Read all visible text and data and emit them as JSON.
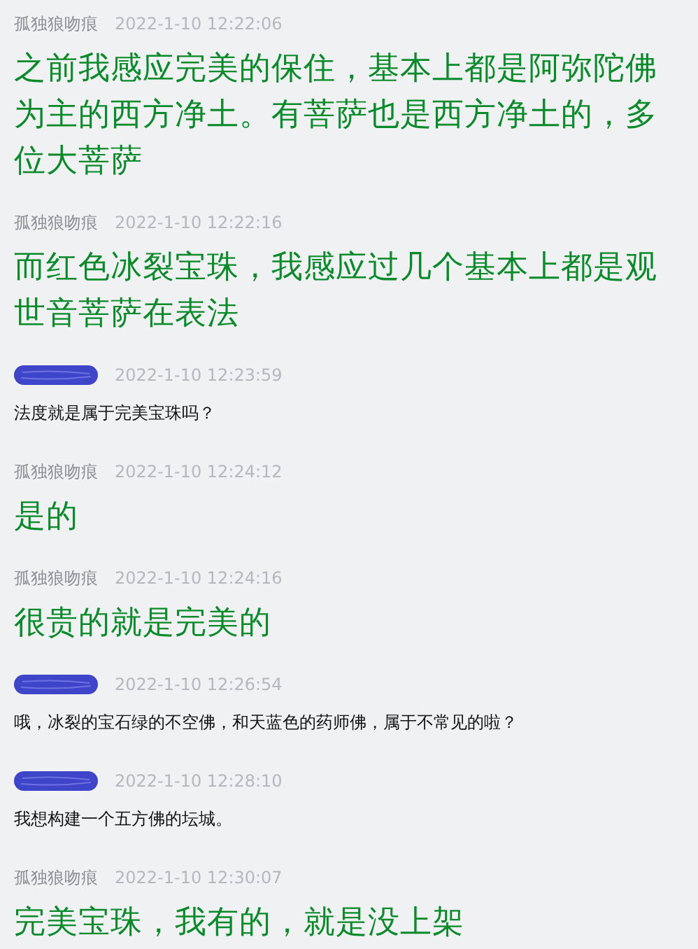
{
  "messages": [
    {
      "sender": "孤独狼吻痕",
      "redacted": false,
      "time": "2022-1-10 12:22:06",
      "kind": "emphasis",
      "text": "之前我感应完美的保住，基本上都是阿弥陀佛为主的西方净土。有菩萨也是西方净土的，多位大菩萨"
    },
    {
      "sender": "孤独狼吻痕",
      "redacted": false,
      "time": "2022-1-10 12:22:16",
      "kind": "emphasis",
      "text": "而红色冰裂宝珠，我感应过几个基本上都是观世音菩萨在表法"
    },
    {
      "redacted": true,
      "time": "2022-1-10 12:23:59",
      "kind": "plain",
      "text": "法度就是属于完美宝珠吗？"
    },
    {
      "sender": "孤独狼吻痕",
      "redacted": false,
      "time": "2022-1-10 12:24:12",
      "kind": "emphasis",
      "text": "是的"
    },
    {
      "sender": "孤独狼吻痕",
      "redacted": false,
      "time": "2022-1-10 12:24:16",
      "kind": "emphasis",
      "text": "很贵的就是完美的"
    },
    {
      "redacted": true,
      "time": "2022-1-10 12:26:54",
      "kind": "plain",
      "text": "哦，冰裂的宝石绿的不空佛，和天蓝色的药师佛，属于不常见的啦？"
    },
    {
      "redacted": true,
      "time": "2022-1-10 12:28:10",
      "kind": "plain",
      "text": "我想构建一个五方佛的坛城。"
    },
    {
      "sender": "孤独狼吻痕",
      "redacted": false,
      "time": "2022-1-10 12:30:07",
      "kind": "emphasis",
      "text": "完美宝珠，我有的，就是没上架"
    }
  ]
}
